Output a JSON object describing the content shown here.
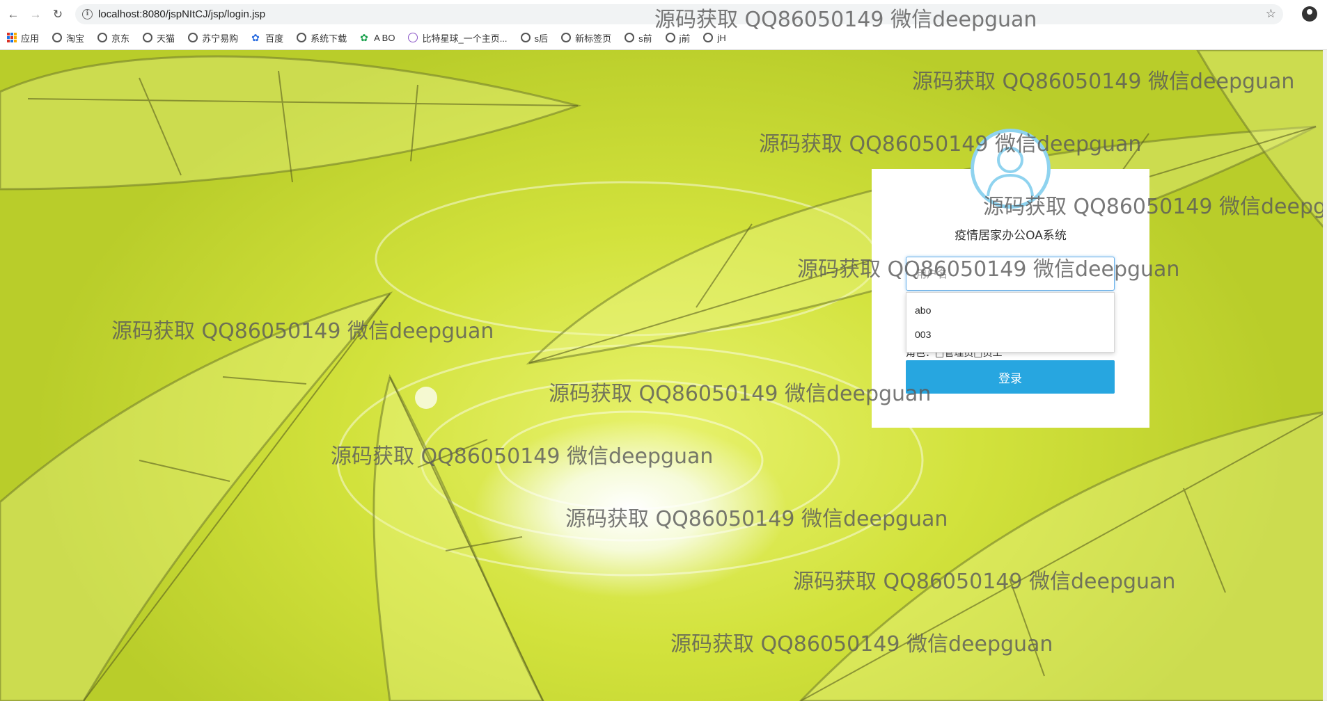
{
  "browser": {
    "url": "localhost:8080/jspNItCJ/jsp/login.jsp",
    "bookmarks": [
      "应用",
      "淘宝",
      "京东",
      "天猫",
      "苏宁易购",
      "百度",
      "系统下载",
      "A BO",
      "比特星球_一个主页...",
      "s后",
      "新标签页",
      "s前",
      "j前",
      "jH"
    ]
  },
  "login": {
    "title": "疫情居家办公OA系统",
    "username_placeholder": "用户名",
    "autocomplete": [
      "abo",
      "003"
    ],
    "role_line": "角色：□管理员□员工",
    "login_button": "登录"
  },
  "watermark": {
    "text": "源码获取 QQ86050149 微信deepguan"
  }
}
